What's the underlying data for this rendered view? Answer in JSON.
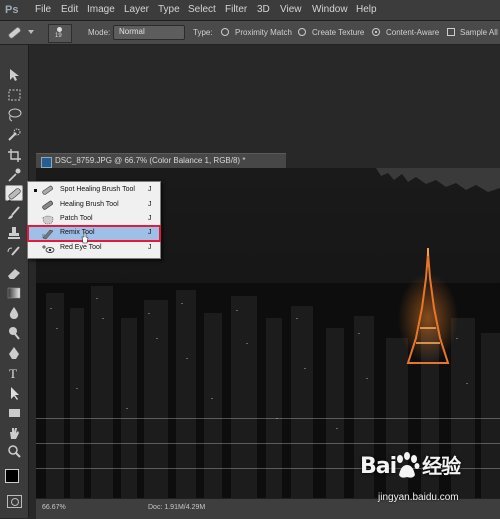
{
  "app": {
    "logo": "Ps"
  },
  "menu": [
    "File",
    "Edit",
    "Image",
    "Layer",
    "Type",
    "Select",
    "Filter",
    "3D",
    "View",
    "Window",
    "Help"
  ],
  "options": {
    "brush_size": "19",
    "mode_label": "Mode:",
    "mode_value": "Normal",
    "type_label": "Type:",
    "type_options": [
      "Proximity Match",
      "Create Texture",
      "Content-Aware"
    ],
    "selected_type": "Content-Aware",
    "sample_label": "Sample All L"
  },
  "document": {
    "tab_title": "DSC_8759.JPG @ 66.7% (Color Balance 1, RGB/8) *",
    "zoom": "66.67%",
    "doc_info": "Doc: 1.91M/4.29M"
  },
  "flyout": {
    "items": [
      {
        "label": "Spot Healing Brush Tool",
        "key": "J",
        "icon": "spot-healing-brush-icon",
        "current": true
      },
      {
        "label": "Healing Brush Tool",
        "key": "J",
        "icon": "healing-brush-icon",
        "current": false
      },
      {
        "label": "Patch Tool",
        "key": "J",
        "icon": "patch-icon",
        "current": false
      },
      {
        "label": "Remix Tool",
        "key": "J",
        "icon": "remix-icon",
        "current": false,
        "highlighted": true
      },
      {
        "label": "Red Eye Tool",
        "key": "J",
        "icon": "red-eye-icon",
        "current": false
      }
    ]
  },
  "watermark": {
    "brand": "Bai",
    "brand_suffix": "经验",
    "url": "jingyan.baidu.com"
  },
  "colors": {
    "menubar": "#3c3c3c",
    "highlight": "#9fbfe7",
    "highlight_border": "#e01b3c",
    "tower": "#e8762a"
  }
}
